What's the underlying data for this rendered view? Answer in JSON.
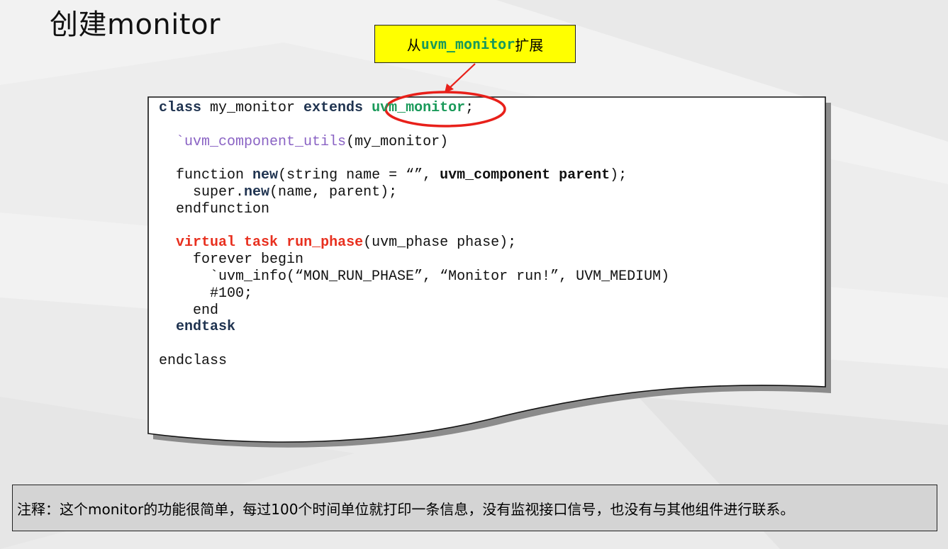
{
  "title": "创建monitor",
  "callout": {
    "prefix": "从",
    "code": "uvm_monitor",
    "suffix": "扩展"
  },
  "code": {
    "l1": {
      "kw1": "class",
      "t1": " my_monitor ",
      "kw2": "extends",
      "t2": " ",
      "base": "uvm_monitor",
      "t3": ";"
    },
    "l3": {
      "indent": "  ",
      "macro": "`uvm_component_utils",
      "t1": "(my_monitor)"
    },
    "l5": {
      "indent": "  ",
      "t1": "function ",
      "kw1": "new",
      "t2": "(string name = “”, ",
      "kw2": "uvm_component parent",
      "t3": ");"
    },
    "l6": {
      "indent": "    ",
      "t1": "super.",
      "kw1": "new",
      "t2": "(name, parent);"
    },
    "l7": {
      "indent": "  ",
      "t1": "endfunction"
    },
    "l9": {
      "indent": "  ",
      "kw1": "virtual",
      "t1": " ",
      "kw2": "task",
      "t2": " ",
      "kw3": "run_phase",
      "t3": "(uvm_phase phase);"
    },
    "l10": {
      "indent": "    ",
      "t1": "forever begin"
    },
    "l11": {
      "indent": "      ",
      "t1": "`uvm_info(“MON_RUN_PHASE”, “Monitor run!”, UVM_MEDIUM)"
    },
    "l12": {
      "indent": "      ",
      "t1": "#100;"
    },
    "l13": {
      "indent": "    ",
      "t1": "end"
    },
    "l14": {
      "indent": "  ",
      "kw1": "endtask"
    },
    "l16": {
      "t1": "endclass"
    }
  },
  "note": "注释：这个monitor的功能很简单，每过100个时间单位就打印一条信息，没有监视接口信号，也没有与其他组件进行联系。",
  "colors": {
    "callout_bg": "#ffff00",
    "highlight_ring": "#e8201a",
    "note_bg": "#d4d4d4"
  }
}
